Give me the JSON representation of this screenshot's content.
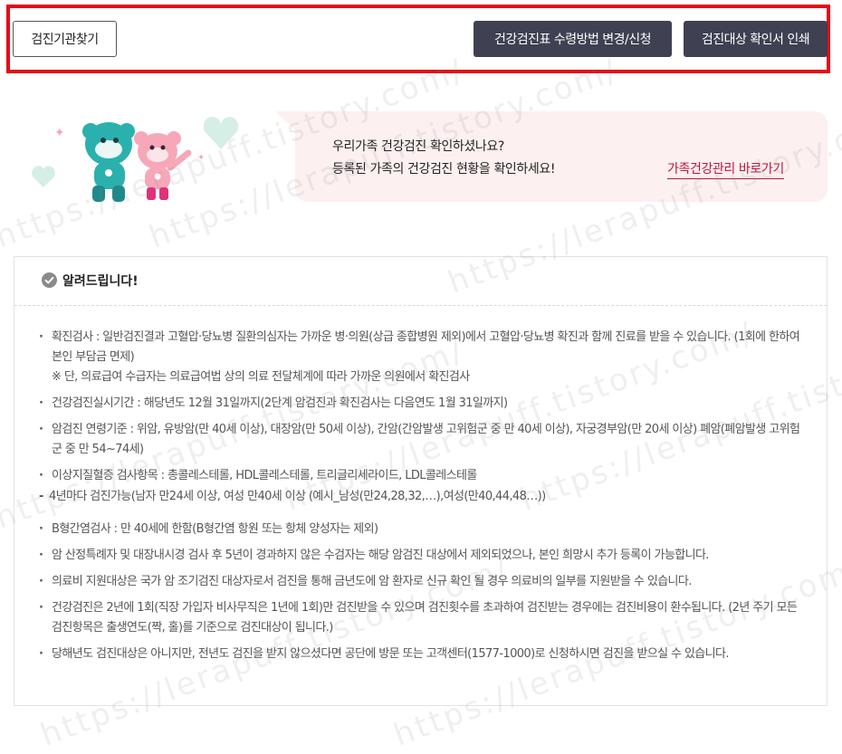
{
  "toolbar": {
    "find_institution_label": "검진기관찾기",
    "change_receipt_label": "건강검진표 수령방법 변경/신청",
    "print_certificate_label": "검진대상 확인서 인쇄",
    "highlight_color": "#e30b17"
  },
  "banner": {
    "line1": "우리가족 건강검진 확인하셨나요?",
    "line2": "등록된 가족의 건강검진 현황을 확인하세요!",
    "link_label": "가족건강관리 바로가기",
    "link_color": "#c0143c"
  },
  "notice": {
    "title": "알려드립니다!",
    "items": [
      {
        "text": "확진검사 : 일반검진결과 고혈압·당뇨병 질환의심자는 가까운 병·의원(상급 종합병원 제외)에서 고혈압·당뇨병 확진과 함께 진료를 받을 수 있습니다. (1회에 한하여 본인 부담금 면제)",
        "note": "※ 단, 의료급여 수급자는 의료급여법 상의 의료 전달체계에 따라 가까운 의원에서 확진검사"
      },
      {
        "text": "건강검진실시기간 : 해당년도 12월 31일까지(2단계 암검진과 확진검사는 다음연도 1월 31일까지)"
      },
      {
        "text": "암검진 연령기준 : 위암, 유방암(만 40세 이상), 대장암(만 50세 이상), 간암(간암발생 고위험군 중 만 40세 이상), 자궁경부암(만 20세 이상) 폐암(폐암발생 고위험군 중 만 54~74세)"
      },
      {
        "text": "이상지질혈증 검사항목 : 총콜레스테롤, HDL콜레스테롤, 트리글리세라이드, LDL콜레스테롤"
      },
      {
        "text": "4년마다 검진가능(남자 만24세 이상, 여성 만40세 이상 (예시_남성(만24,28,32,…),여성(만40,44,48…))",
        "sub": true
      },
      {
        "text": "B형간염검사 : 만 40세에 한함(B형간염 항원 또는 항체 양성자는 제외)"
      },
      {
        "text": "암 산정특례자 및 대장내시경 검사 후 5년이 경과하지 않은 수검자는 해당 암검진 대상에서 제외되었으나, 본인 희망시 추가 등록이 가능합니다."
      },
      {
        "text": "의료비 지원대상은 국가 암 조기검진 대상자로서 검진을 통해 금년도에 암 환자로 신규 확인 될 경우 의료비의 일부를 지원받을 수 있습니다."
      },
      {
        "text": "건강검진은 2년에 1회(직장 가입자 비사무직은 1년에 1회)만 검진받을 수 있으며 검진횟수를 초과하여 검진받는 경우에는 검진비용이 환수됩니다. (2년 주기 모든 검진항목은 출생연도(짝, 홀)를 기준으로 검진대상이 됩니다.)"
      },
      {
        "text": "당해년도 검진대상은 아니지만, 전년도 검진을 받지 않으셨다면 공단에 방문 또는 고객센터(1577-1000)로 신청하시면 검진을 받으실 수 있습니다."
      }
    ]
  },
  "watermark": "https://lerapuff.tistory.com/"
}
